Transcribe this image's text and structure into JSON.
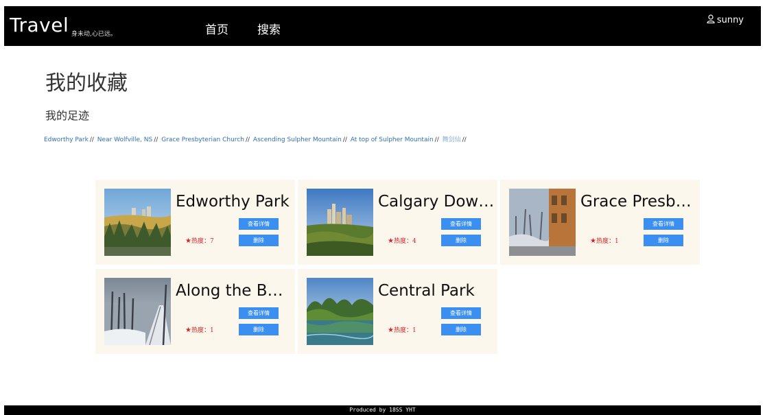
{
  "header": {
    "brand": "Travel",
    "slogan": "身未动,心已远。",
    "nav": {
      "home": "首页",
      "search": "搜索"
    },
    "user": {
      "name": "sunny",
      "icon": "user-icon"
    }
  },
  "page": {
    "title": "我的收藏",
    "footprints_title": "我的足迹"
  },
  "footprints": {
    "items": [
      "Edworthy Park",
      "Near Wolfville, NS",
      "Grace Presbyterian Church",
      "Ascending Sulpher Mountain",
      "At top of Sulpher Mountain",
      "舞剑仙"
    ],
    "separator": "//",
    "colors": {
      "link": "#2f6fb8",
      "visited": "#8fb1d8"
    }
  },
  "favorites": [
    {
      "title": "Edworthy Park",
      "heat": "热度：7",
      "detail_label": "查看详情",
      "delete_label": "删除"
    },
    {
      "title": "Calgary Downtown",
      "heat": "热度：4",
      "detail_label": "查看详情",
      "delete_label": "删除"
    },
    {
      "title": "Grace Presbyterian Church",
      "heat": "热度：1",
      "detail_label": "查看详情",
      "delete_label": "删除"
    },
    {
      "title": "Along the Bow River",
      "heat": "热度：1",
      "detail_label": "查看详情",
      "delete_label": "删除"
    },
    {
      "title": "Central Park",
      "heat": "热度：1",
      "detail_label": "查看详情",
      "delete_label": "删除"
    }
  ],
  "footer": {
    "text": "Produced by 18SS YHT"
  },
  "colors": {
    "button": "#3a8ff0",
    "card_bg": "#fbf7ec",
    "heat": "#e02020",
    "bar": "#000000"
  }
}
